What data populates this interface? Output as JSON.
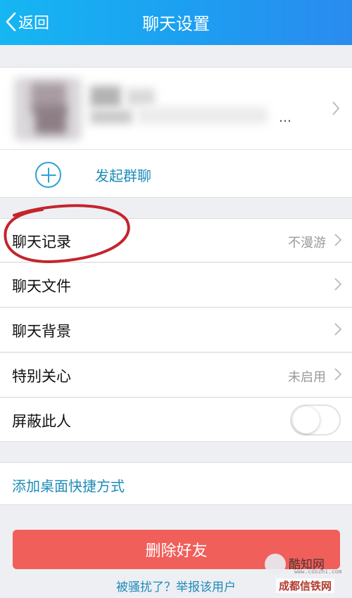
{
  "header": {
    "back_label": "返回",
    "title": "聊天设置",
    "gradient_start": "#16b6f2",
    "gradient_end": "#2a8bef"
  },
  "profile": {
    "ellipsis": "…",
    "avatar_blurred": true,
    "name_blurred": true
  },
  "group_action": {
    "icon": "plus-circle-icon",
    "label": "发起群聊"
  },
  "settings": {
    "items": [
      {
        "label": "聊天记录",
        "value": "不漫游",
        "chevron": true,
        "circled": true
      },
      {
        "label": "聊天文件",
        "value": "",
        "chevron": true
      },
      {
        "label": "聊天背景",
        "value": "",
        "chevron": true
      },
      {
        "label": "特别关心",
        "value": "未启用",
        "chevron": true
      },
      {
        "label": "屏蔽此人",
        "toggle": false
      }
    ]
  },
  "shortcut": {
    "label": "添加桌面快捷方式"
  },
  "delete_button": {
    "label": "删除好友",
    "color": "#f05f5a"
  },
  "report_link": {
    "label": "被骚扰了？举报该用户"
  },
  "watermark": {
    "brand": "酷知网",
    "url": "www.coozhi.com",
    "stamp": "成都信铁网"
  },
  "colors": {
    "accent_text": "#1e8bb8",
    "background": "#eeeff3",
    "annotation": "#c4242c"
  }
}
